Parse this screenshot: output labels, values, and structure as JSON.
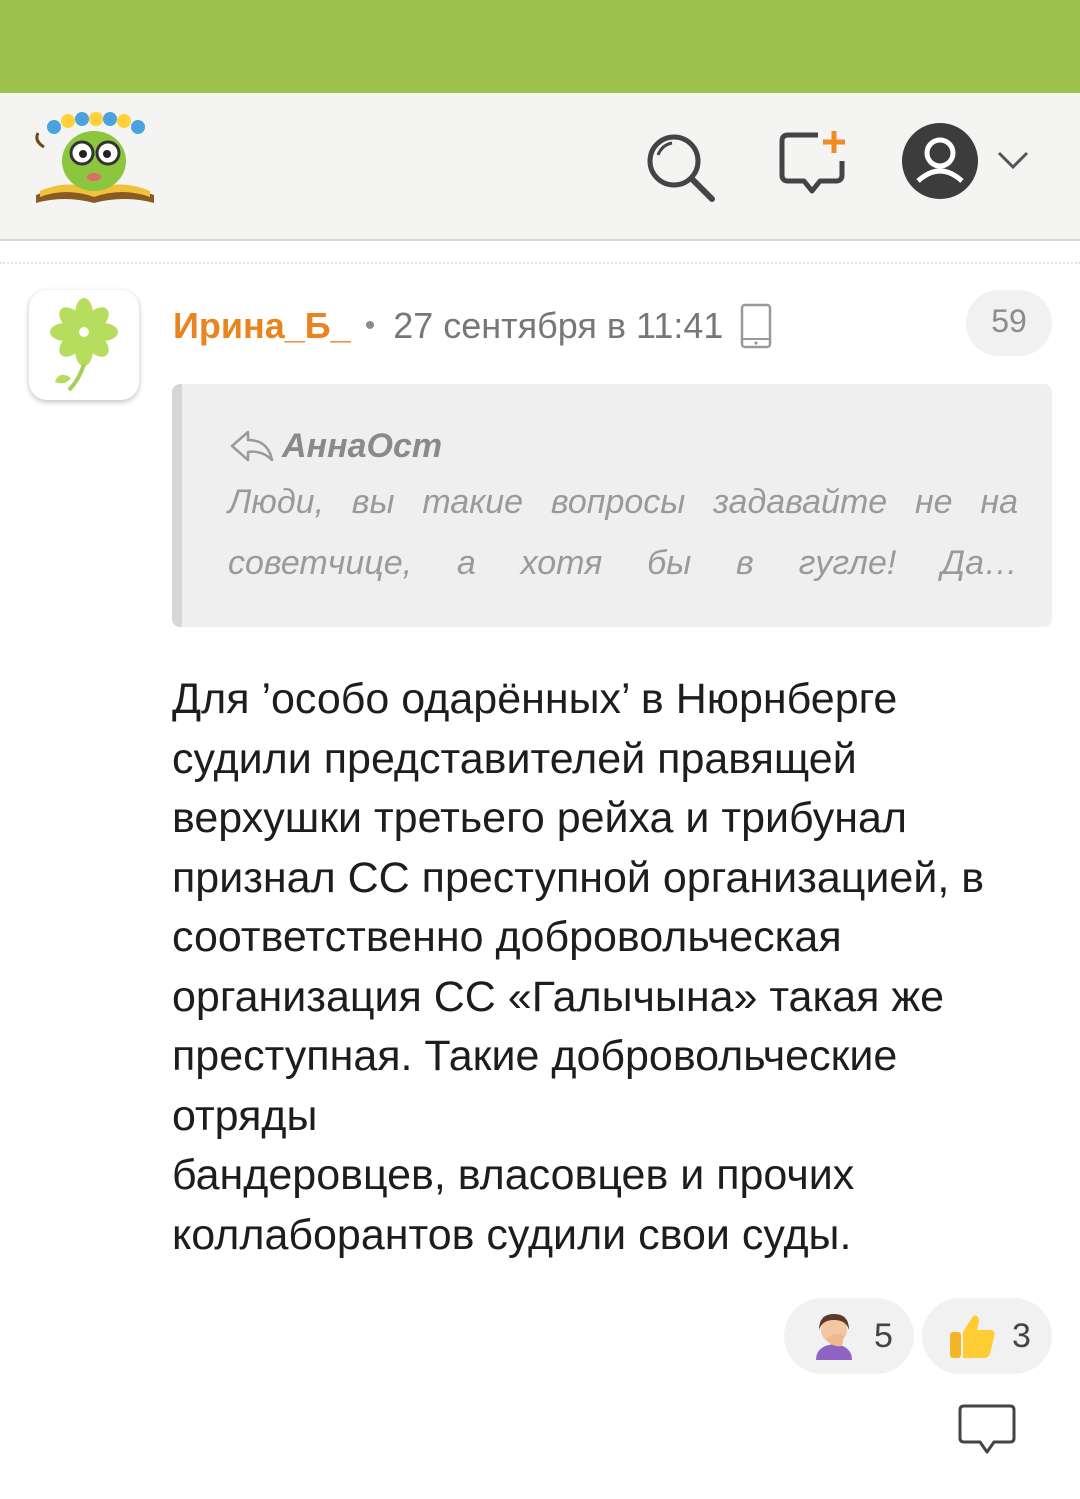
{
  "header": {
    "icons": [
      "logo-icon",
      "search-icon",
      "new-question-icon",
      "user-avatar-icon",
      "chevron-down-icon"
    ]
  },
  "post": {
    "author": "Ирина_Б_",
    "separator": "•",
    "date": "27 сентября в 11:41",
    "device_icon": "phone-icon",
    "count": "59",
    "quote": {
      "author": "АннаОст",
      "text": "Люди, вы такие вопросы задавайте не на советчице, а хотя бы в гугле! Да…"
    },
    "body": "Для ’особо одарённых’ в Нюрнберге судили представителей правящей верхушки третьего рейха и трибунал признал СС преступной организацией, в соответственно добровольческая организация СС «Галычына» такая же преступная. Такие добровольческие отряды\nбандеровцев, власовцев и прочих коллаборантов судили свои суды.",
    "reactions": [
      {
        "icon": "facepalm-icon",
        "count": "5"
      },
      {
        "icon": "thumbs-up-icon",
        "count": "3"
      }
    ]
  },
  "colors": {
    "status_bar": "#9dc14a",
    "header_bg": "#f4f4f2",
    "author": "#e88521",
    "quote_bg": "#efefef"
  }
}
